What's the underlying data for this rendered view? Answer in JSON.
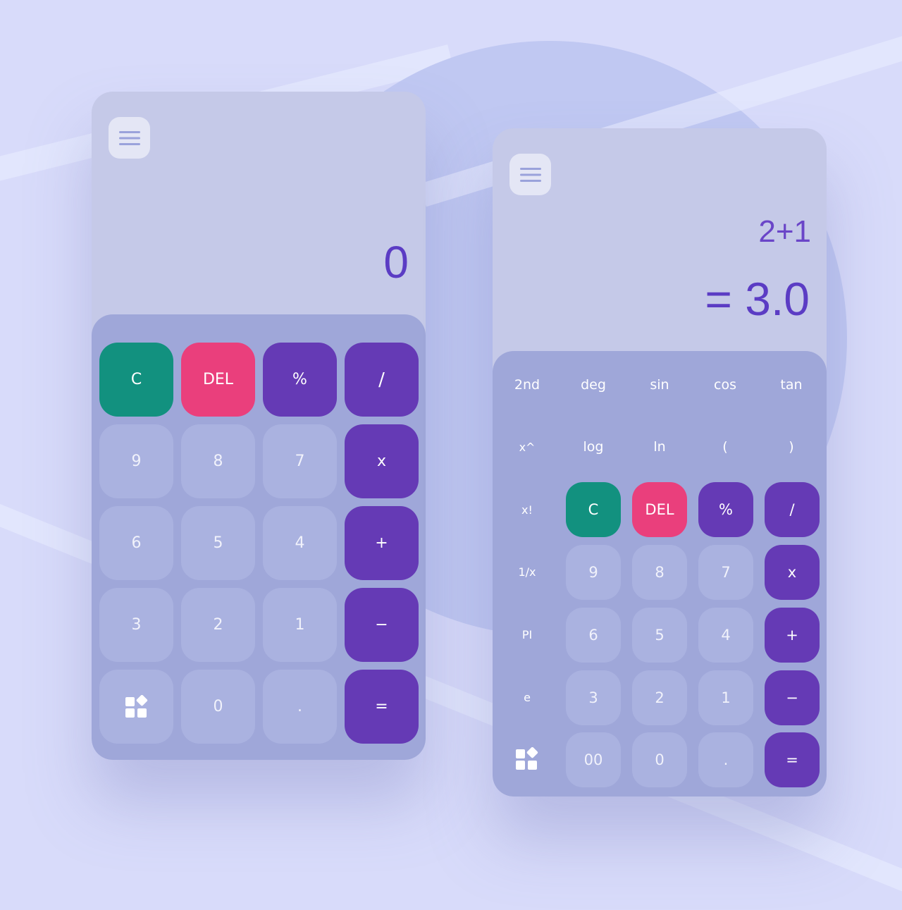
{
  "colors": {
    "background": "#d8dbfa",
    "screen": "#c5c9e8",
    "keypad": "#9fa7d9",
    "num_key": "#aab2e0",
    "clear": "#12917f",
    "delete": "#ea3f7c",
    "operator": "#653ab5",
    "display_text": "#5b3cc4"
  },
  "left_calc": {
    "display": "0",
    "keys": [
      "C",
      "DEL",
      "%",
      "/",
      "9",
      "8",
      "7",
      "x",
      "6",
      "5",
      "4",
      "+",
      "3",
      "2",
      "1",
      "−",
      "0",
      ".",
      "="
    ]
  },
  "right_calc": {
    "expression": "2+1",
    "result": "= 3.0",
    "scientific": [
      "2nd",
      "deg",
      "sin",
      "cos",
      "tan",
      "x^",
      "log",
      "ln",
      "(",
      ")",
      "x!",
      "1/x",
      "PI",
      "e"
    ],
    "keys": [
      "C",
      "DEL",
      "%",
      "/",
      "9",
      "8",
      "7",
      "x",
      "6",
      "5",
      "4",
      "+",
      "3",
      "2",
      "1",
      "−",
      "00",
      "0",
      ".",
      "="
    ]
  },
  "icons": {
    "menu": "hamburger-menu-icon",
    "apps": "grid-shapes-icon"
  }
}
